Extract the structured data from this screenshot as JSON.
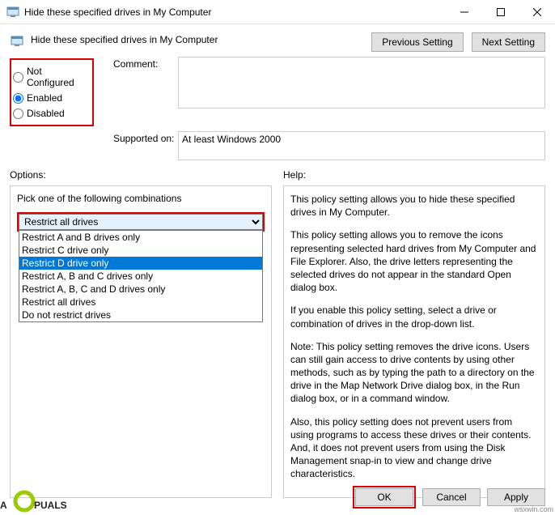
{
  "window": {
    "title": "Hide these specified drives in My Computer"
  },
  "header": {
    "title": "Hide these specified drives in My Computer",
    "prev": "Previous Setting",
    "next": "Next Setting"
  },
  "state": {
    "not_configured": "Not Configured",
    "enabled": "Enabled",
    "disabled": "Disabled",
    "selected": "enabled"
  },
  "labels": {
    "comment": "Comment:",
    "supported": "Supported on:",
    "options": "Options:",
    "help": "Help:"
  },
  "fields": {
    "comment": "",
    "supported": "At least Windows 2000"
  },
  "options_panel": {
    "prompt": "Pick one of the following combinations",
    "selected": "Restrict all drives",
    "items": [
      "Restrict A and B drives only",
      "Restrict C drive only",
      "Restrict D drive only",
      "Restrict A, B and C drives only",
      "Restrict A, B, C and D drives only",
      "Restrict all drives",
      "Do not restrict drives"
    ],
    "highlighted_index": 2
  },
  "help_text": {
    "p1": "This policy setting allows you to hide these specified drives in My Computer.",
    "p2": "This policy setting allows you to remove the icons representing selected hard drives from My Computer and File Explorer. Also, the drive letters representing the selected drives do not appear in the standard Open dialog box.",
    "p3": "If you enable this policy setting, select a drive or combination of drives in the drop-down list.",
    "p4": "Note: This policy setting removes the drive icons. Users can still gain access to drive contents by using other methods, such as by typing the path to a directory on the drive in the Map Network Drive dialog box, in the Run dialog box, or in a command window.",
    "p5": "Also, this policy setting does not prevent users from using programs to access these drives or their contents. And, it does not prevent users from using the Disk Management snap-in to view and change drive characteristics."
  },
  "buttons": {
    "ok": "OK",
    "cancel": "Cancel",
    "apply": "Apply"
  },
  "marks": {
    "wm": "wsxwin.com"
  }
}
